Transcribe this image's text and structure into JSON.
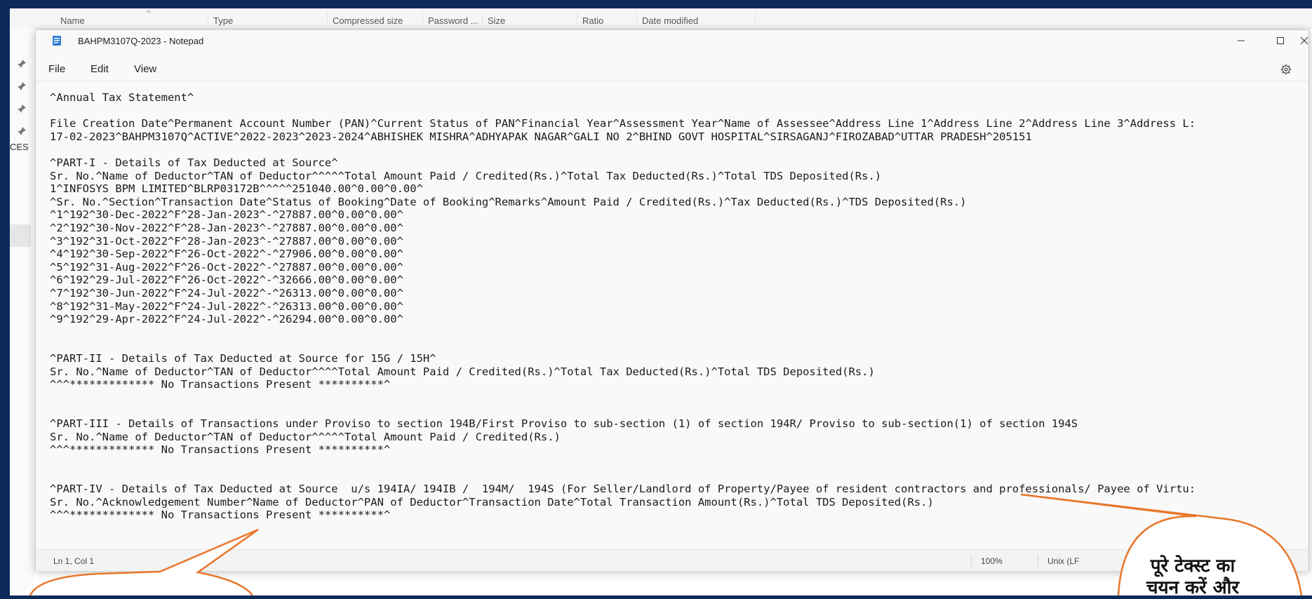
{
  "explorer_header": {
    "columns": [
      "Name",
      "Type",
      "Compressed size",
      "Password ...",
      "Size",
      "Ratio",
      "Date modified"
    ]
  },
  "explorer_side": {
    "label": "CES"
  },
  "notepad": {
    "title": "BAHPM3107Q-2023 - Notepad",
    "menu": {
      "file": "File",
      "edit": "Edit",
      "view": "View"
    },
    "lines": [
      "^Annual Tax Statement^",
      "",
      "File Creation Date^Permanent Account Number (PAN)^Current Status of PAN^Financial Year^Assessment Year^Name of Assessee^Address Line 1^Address Line 2^Address Line 3^Address L:",
      "17-02-2023^BAHPM3107Q^ACTIVE^2022-2023^2023-2024^ABHISHEK MISHRA^ADHYAPAK NAGAR^GALI NO 2^BHIND GOVT HOSPITAL^SIRSAGANJ^FIROZABAD^UTTAR PRADESH^205151",
      "",
      "^PART-I - Details of Tax Deducted at Source^",
      "Sr. No.^Name of Deductor^TAN of Deductor^^^^^Total Amount Paid / Credited(Rs.)^Total Tax Deducted(Rs.)^Total TDS Deposited(Rs.)",
      "1^INFOSYS BPM LIMITED^BLRP03172B^^^^^251040.00^0.00^0.00^",
      "^Sr. No.^Section^Transaction Date^Status of Booking^Date of Booking^Remarks^Amount Paid / Credited(Rs.)^Tax Deducted(Rs.)^TDS Deposited(Rs.)",
      "^1^192^30-Dec-2022^F^28-Jan-2023^-^27887.00^0.00^0.00^",
      "^2^192^30-Nov-2022^F^28-Jan-2023^-^27887.00^0.00^0.00^",
      "^3^192^31-Oct-2022^F^28-Jan-2023^-^27887.00^0.00^0.00^",
      "^4^192^30-Sep-2022^F^26-Oct-2022^-^27906.00^0.00^0.00^",
      "^5^192^31-Aug-2022^F^26-Oct-2022^-^27887.00^0.00^0.00^",
      "^6^192^29-Jul-2022^F^26-Oct-2022^-^32666.00^0.00^0.00^",
      "^7^192^30-Jun-2022^F^24-Jul-2022^-^26313.00^0.00^0.00^",
      "^8^192^31-May-2022^F^24-Jul-2022^-^26313.00^0.00^0.00^",
      "^9^192^29-Apr-2022^F^24-Jul-2022^-^26294.00^0.00^0.00^",
      "",
      "",
      "^PART-II - Details of Tax Deducted at Source for 15G / 15H^",
      "Sr. No.^Name of Deductor^TAN of Deductor^^^^Total Amount Paid / Credited(Rs.)^Total Tax Deducted(Rs.)^Total TDS Deposited(Rs.)",
      "^^^************* No Transactions Present **********^",
      "",
      "",
      "^PART-III - Details of Transactions under Proviso to section 194B/First Proviso to sub-section (1) of section 194R/ Proviso to sub-section(1) of section 194S",
      "Sr. No.^Name of Deductor^TAN of Deductor^^^^^Total Amount Paid / Credited(Rs.)",
      "^^^************* No Transactions Present **********^",
      "",
      "",
      "^PART-IV - Details of Tax Deducted at Source  u/s 194IA/ 194IB /  194M/  194S (For Seller/Landlord of Property/Payee of resident contractors and professionals/ Payee of Virtu:",
      "Sr. No.^Acknowledgement Number^Name of Deductor^PAN of Deductor^Transaction Date^Total Transaction Amount(Rs.)^Total TDS Deposited(Rs.)",
      "^^^************* No Transactions Present **********^"
    ],
    "status": {
      "position": "Ln 1, Col 1",
      "zoom": "100%",
      "line_ending": "Unix (LF"
    }
  },
  "callout": {
    "line1": "पूरे टेक्स्ट का",
    "line2": "चयन करें और"
  },
  "colors": {
    "callout_border": "#e8762b",
    "desktop_frame": "#0d2a5c"
  }
}
